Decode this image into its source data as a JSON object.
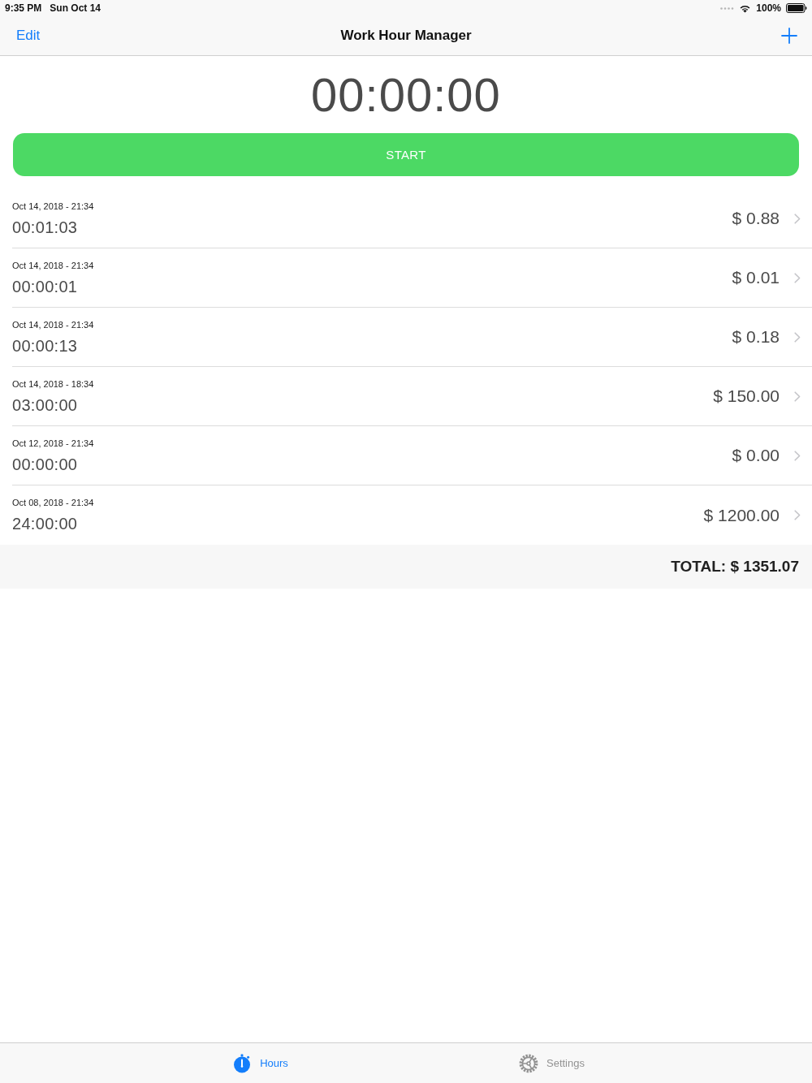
{
  "status_bar": {
    "time": "9:35 PM",
    "date": "Sun Oct 14",
    "battery": "100%"
  },
  "nav_bar": {
    "left_button": "Edit",
    "title": "Work Hour Manager"
  },
  "timer": {
    "display": "00:00:00"
  },
  "start_button": {
    "label": "START"
  },
  "entries": [
    {
      "date": "Oct 14, 2018 - 21:34",
      "duration": "00:01:03",
      "amount": "$ 0.88"
    },
    {
      "date": "Oct 14, 2018 - 21:34",
      "duration": "00:00:01",
      "amount": "$ 0.01"
    },
    {
      "date": "Oct 14, 2018 - 21:34",
      "duration": "00:00:13",
      "amount": "$ 0.18"
    },
    {
      "date": "Oct 14, 2018 - 18:34",
      "duration": "03:00:00",
      "amount": "$ 150.00"
    },
    {
      "date": "Oct 12, 2018 - 21:34",
      "duration": "00:00:00",
      "amount": "$ 0.00"
    },
    {
      "date": "Oct 08, 2018 - 21:34",
      "duration": "24:00:00",
      "amount": "$ 1200.00"
    }
  ],
  "total": "TOTAL: $ 1351.07",
  "tabs": [
    {
      "label": "Hours",
      "selected": true,
      "kind": "stopwatch"
    },
    {
      "label": "Settings",
      "selected": false,
      "kind": "gear"
    }
  ]
}
